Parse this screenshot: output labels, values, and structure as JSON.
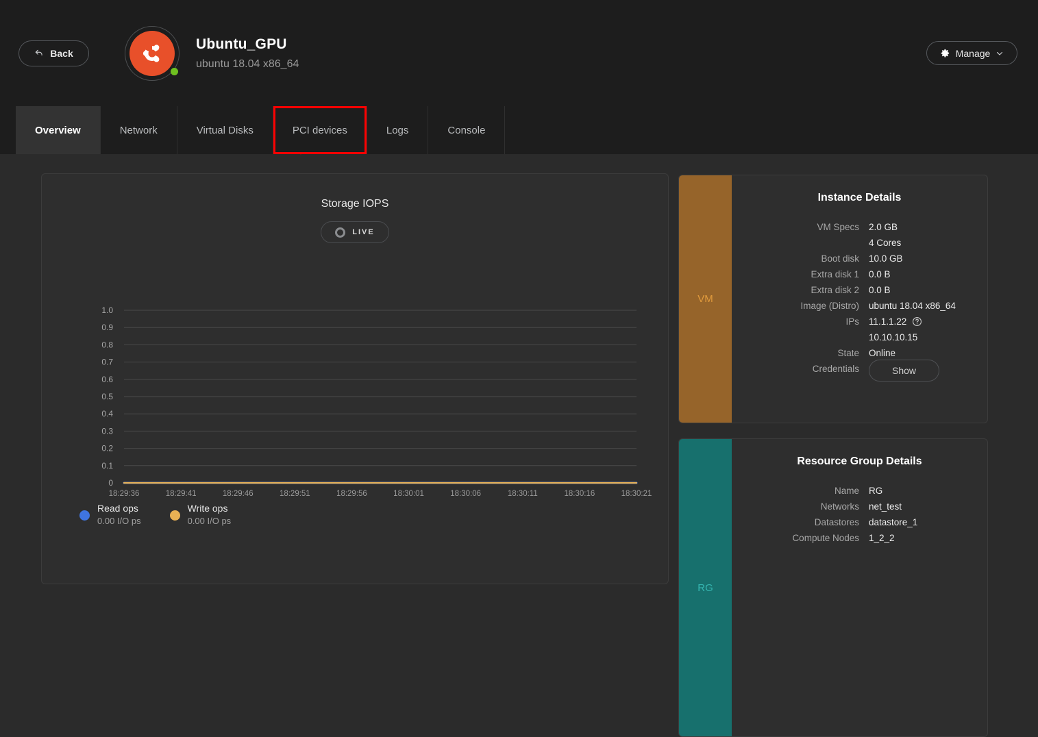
{
  "header": {
    "back_label": "Back",
    "back_icon": "back-arrow-icon",
    "vm_name": "Ubuntu_GPU",
    "vm_os": "ubuntu 18.04 x86_64",
    "logo_icon": "ubuntu-logo-icon",
    "status_icon": "online-status-dot",
    "manage_label": "Manage",
    "manage_icon": "gear-icon",
    "manage_caret_icon": "chevron-down-icon",
    "colors": {
      "header_bg": "#1d1d1d",
      "logo": "#e8502a",
      "status": "#6fc020"
    }
  },
  "tabs": [
    {
      "label": "Overview",
      "active": true,
      "highlighted": false
    },
    {
      "label": "Network",
      "active": false,
      "highlighted": false
    },
    {
      "label": "Virtual Disks",
      "active": false,
      "highlighted": false
    },
    {
      "label": "PCI devices",
      "active": false,
      "highlighted": true
    },
    {
      "label": "Logs",
      "active": false,
      "highlighted": false
    },
    {
      "label": "Console",
      "active": false,
      "highlighted": false
    }
  ],
  "annotation": {
    "highlight_color": "#ff0000",
    "arrow_icon": "red-up-arrow-annotation",
    "target_tab": "PCI devices"
  },
  "chart_panel": {
    "title": "Storage IOPS",
    "live_label": "LIVE",
    "live_icon": "live-record-icon"
  },
  "chart_data": {
    "type": "line",
    "title": "Storage IOPS",
    "xlabel": "",
    "ylabel": "",
    "ylim": [
      0,
      1.0
    ],
    "grid": true,
    "legend_position": "bottom-left",
    "y_ticks": [
      "1.0",
      "0.9",
      "0.8",
      "0.7",
      "0.6",
      "0.5",
      "0.4",
      "0.3",
      "0.2",
      "0.1",
      "0"
    ],
    "x": [
      "18:29:36",
      "18:29:41",
      "18:29:46",
      "18:29:51",
      "18:29:56",
      "18:30:01",
      "18:30:06",
      "18:30:11",
      "18:30:16",
      "18:30:21"
    ],
    "series": [
      {
        "name": "Read ops",
        "value_label": "0.00 I/O ps",
        "color": "#3f74e0",
        "values": [
          0,
          0,
          0,
          0,
          0,
          0,
          0,
          0,
          0,
          0
        ]
      },
      {
        "name": "Write ops",
        "value_label": "0.00 I/O ps",
        "color": "#e8b154",
        "values": [
          0,
          0,
          0,
          0,
          0,
          0,
          0,
          0,
          0,
          0
        ]
      }
    ]
  },
  "instance_details": {
    "stripe_label": "VM",
    "stripe_color": "#96642a",
    "title": "Instance Details",
    "rows": [
      {
        "key": "VM Specs",
        "value": "2.0 GB"
      },
      {
        "key": "",
        "value": "4 Cores"
      },
      {
        "key": "Boot disk",
        "value": "10.0 GB"
      },
      {
        "key": "Extra disk 1",
        "value": "0.0 B"
      },
      {
        "key": "Extra disk 2",
        "value": "0.0 B"
      },
      {
        "key": "Image (Distro)",
        "value": "ubuntu 18.04 x86_64"
      },
      {
        "key": "IPs",
        "value": "11.1.1.22"
      },
      {
        "key": "",
        "value": "10.10.10.15"
      },
      {
        "key": "State",
        "value": "Online"
      }
    ],
    "credentials_key": "Credentials",
    "credentials_button": "Show",
    "help_icon": "help-question-icon"
  },
  "resource_group_details": {
    "stripe_label": "RG",
    "stripe_color": "#17706d",
    "title": "Resource Group Details",
    "rows": [
      {
        "key": "Name",
        "value": "RG"
      },
      {
        "key": "Networks",
        "value": "net_test"
      },
      {
        "key": "Datastores",
        "value": "datastore_1"
      },
      {
        "key": "Compute Nodes",
        "value": "1_2_2"
      }
    ]
  }
}
